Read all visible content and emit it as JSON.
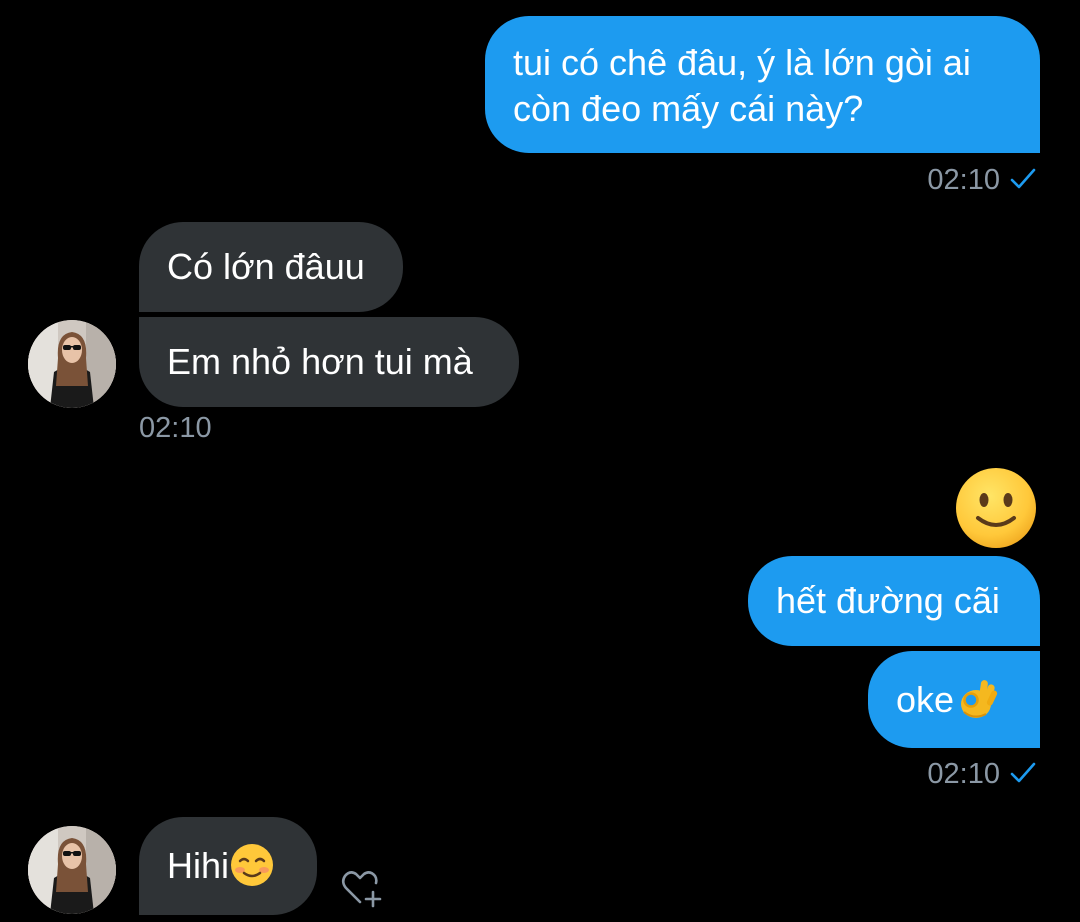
{
  "messages": [
    {
      "id": "m1",
      "direction": "outgoing",
      "text_line1": "tui có chê đâu, ý là lớn gòi ai",
      "text_line2": "còn đeo mấy cái này?"
    },
    {
      "id": "m2",
      "direction": "incoming",
      "text": "Có lớn đâuu"
    },
    {
      "id": "m3",
      "direction": "incoming",
      "text": "Em nhỏ hơn tui mà"
    },
    {
      "id": "m4",
      "direction": "outgoing",
      "emoji": "slightly-smiling-face"
    },
    {
      "id": "m5",
      "direction": "outgoing",
      "text": "hết đường cãi"
    },
    {
      "id": "m6",
      "direction": "outgoing",
      "text": "oke",
      "emoji": "ok-hand"
    },
    {
      "id": "m7",
      "direction": "incoming",
      "text": "Hihi",
      "emoji": "smiling-face"
    }
  ],
  "timestamps": {
    "t1": "02:10",
    "t2": "02:10",
    "t3": "02:10"
  },
  "icons": {
    "read_receipt": "check-icon",
    "reaction": "heart-plus-icon",
    "avatar": "user-avatar"
  },
  "colors": {
    "background": "#000000",
    "outgoing_bubble": "#1d9bf0",
    "incoming_bubble": "#2f3336",
    "timestamp": "#8b98a5",
    "check": "#1d9bf0"
  }
}
